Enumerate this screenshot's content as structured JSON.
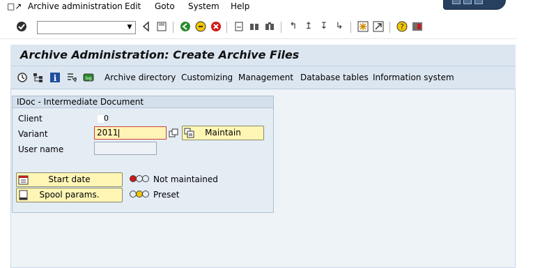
{
  "menubar": {
    "items": [
      "Archive administration",
      "Edit",
      "Goto",
      "System",
      "Help"
    ]
  },
  "toolbar": {
    "command_field_value": "",
    "icons": [
      "enter-icon",
      "back-icon",
      "save-icon",
      "back-nav-icon",
      "exit-icon",
      "cancel-icon",
      "print-icon",
      "find-icon",
      "find-next-icon",
      "first-page-icon",
      "previous-page-icon",
      "next-page-icon",
      "last-page-icon",
      "create-session-icon",
      "create-shortcut-icon",
      "help-icon",
      "customize-layout-icon"
    ]
  },
  "page": {
    "title": "Archive Administration: Create Archive Files"
  },
  "app_toolbar": {
    "icons": [
      "execute-icon",
      "structure-icon",
      "info-icon",
      "job-overview-icon",
      "log-icon"
    ],
    "links": [
      "Archive directory",
      "Customizing",
      "Management",
      "Database tables",
      "Information system"
    ]
  },
  "group": {
    "title": "IDoc - Intermediate Document",
    "client_label": "Client",
    "client_value": "0",
    "variant_label": "Variant",
    "variant_value": "2011",
    "user_label": "User name",
    "user_value": "",
    "maintain_button": "Maintain",
    "start_date_button": "Start date",
    "spool_button": "Spool params.",
    "status_not_maintained": "Not maintained",
    "status_preset": "Preset"
  },
  "colors": {
    "panel_bg": "#eef3f8",
    "title_bar": "#dbe6f1",
    "button_yellow": "#fff6b6",
    "red_light": "#d01818",
    "yellow_light": "#f2c500"
  }
}
